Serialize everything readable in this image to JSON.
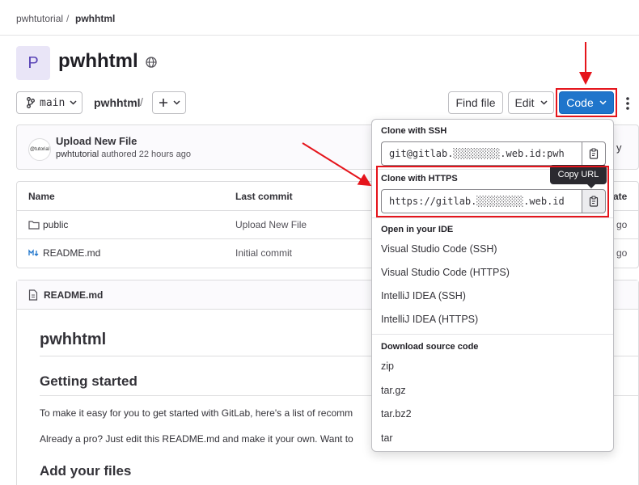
{
  "breadcrumb": {
    "group": "pwhtutorial",
    "separator": "/",
    "project": "pwhhtml"
  },
  "project": {
    "avatar_letter": "P",
    "name": "pwhhtml"
  },
  "toolbar": {
    "branch": "main",
    "path": "pwhhtml",
    "path_sep": "/",
    "find_file": "Find file",
    "edit": "Edit",
    "code": "Code"
  },
  "commit": {
    "avatar_text": "@tutorial",
    "title": "Upload New File",
    "author": "pwhtutorial",
    "meta": "authored 22 hours ago",
    "partial_button": "y"
  },
  "files": {
    "headers": {
      "name": "Name",
      "last_commit": "Last commit",
      "date_partial": "ate"
    },
    "rows": [
      {
        "name": "public",
        "commit": "Upload New File",
        "date_partial": "go"
      },
      {
        "name": "README.md",
        "commit": "Initial commit",
        "date_partial": "go"
      }
    ]
  },
  "readme": {
    "file": "README.md",
    "h1": "pwhhtml",
    "h2": "Getting started",
    "p1": "To make it easy for you to get started with GitLab, here's a list of recomm",
    "p2": "Already a pro? Just edit this README.md and make it your own. Want to",
    "h2b": "Add your files"
  },
  "clone": {
    "ssh_heading": "Clone with SSH",
    "ssh_url": "git@gitlab.░░░░░░░░.web.id:pwh",
    "https_heading": "Clone with HTTPS",
    "https_url": "https://gitlab.░░░░░░░░.web.id",
    "ide_heading": "Open in your IDE",
    "ide_items": [
      "Visual Studio Code (SSH)",
      "Visual Studio Code (HTTPS)",
      "IntelliJ IDEA (SSH)",
      "IntelliJ IDEA (HTTPS)"
    ],
    "download_heading": "Download source code",
    "download_items": [
      "zip",
      "tar.gz",
      "tar.bz2",
      "tar"
    ],
    "tooltip": "Copy URL"
  },
  "colors": {
    "accent": "#1f75cb",
    "annotation": "#e5141b",
    "tooltip": "#2b2a30"
  },
  "icons": [
    "globe-icon",
    "branch-icon",
    "chevron-down-icon",
    "plus-icon",
    "kebab-icon",
    "folder-icon",
    "markdown-icon",
    "file-icon",
    "clipboard-icon"
  ]
}
